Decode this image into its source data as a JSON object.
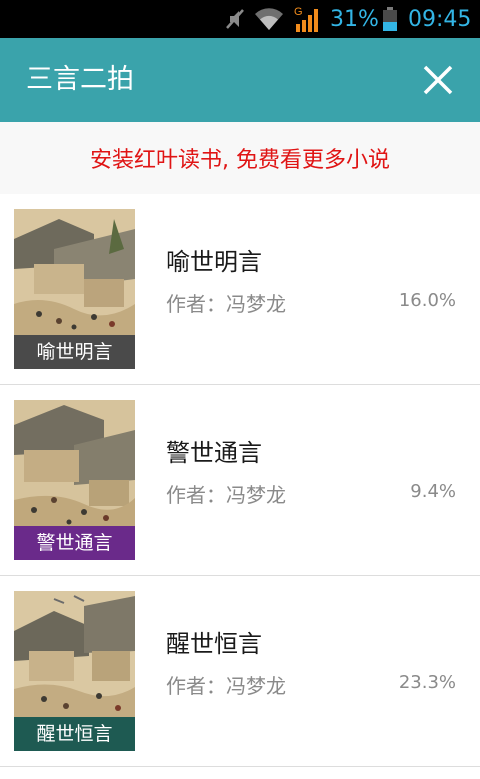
{
  "status_bar": {
    "battery_percent": "31%",
    "time": "09:45",
    "network_label": "G",
    "icons": [
      "mute-icon",
      "wifi-icon",
      "signal-icon",
      "battery-icon"
    ],
    "accent_color": "#33b5e5"
  },
  "header": {
    "title": "三言二拍",
    "close_icon": "close-icon",
    "background_color": "#3aa3ab"
  },
  "banner": {
    "text": "安装红叶读书, 免费看更多小说",
    "text_color": "#e01414"
  },
  "books": [
    {
      "title": "喻世明言",
      "cover_label": "喻世明言",
      "author": "作者：冯梦龙",
      "progress": "16.0%",
      "label_color": "#4a4a4a"
    },
    {
      "title": "警世通言",
      "cover_label": "警世通言",
      "author": "作者：冯梦龙",
      "progress": "9.4%",
      "label_color": "#6a2a8a"
    },
    {
      "title": "醒世恒言",
      "cover_label": "醒世恒言",
      "author": "作者：冯梦龙",
      "progress": "23.3%",
      "label_color": "#1e5a52"
    }
  ]
}
